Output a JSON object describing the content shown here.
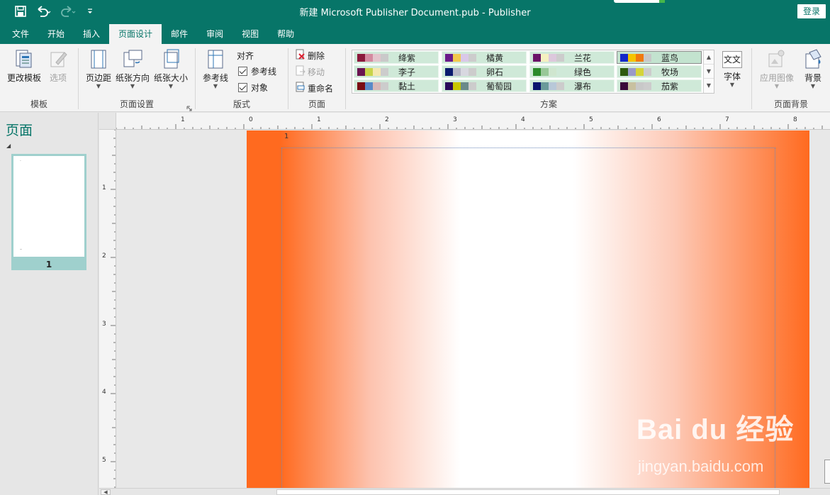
{
  "window": {
    "title": "新建 Microsoft Publisher Document.pub  -  Publisher",
    "login_label": "登录"
  },
  "qat": {
    "save_icon": "save-icon",
    "undo_icon": "undo-icon",
    "redo_icon": "redo-icon",
    "customize_icon": "customize-qat-icon"
  },
  "tabs": [
    {
      "label": "文件"
    },
    {
      "label": "开始"
    },
    {
      "label": "插入"
    },
    {
      "label": "页面设计",
      "active": true
    },
    {
      "label": "邮件"
    },
    {
      "label": "审阅"
    },
    {
      "label": "视图"
    },
    {
      "label": "帮助"
    }
  ],
  "ribbon": {
    "template_group": {
      "label": "模板",
      "change_template": "更改模板",
      "options": "选项"
    },
    "page_setup_group": {
      "label": "页面设置",
      "margins": "页边距",
      "orientation": "纸张方向",
      "size": "纸张大小"
    },
    "layout_group": {
      "label": "版式",
      "guides": "参考线",
      "align_label": "对齐",
      "align_guides": "参考线",
      "align_objects": "对象"
    },
    "pages_group": {
      "label": "页面",
      "delete": "删除",
      "move": "移动",
      "rename": "重命名"
    },
    "schemes_group": {
      "label": "方案",
      "font_label": "字体",
      "font_icon_text": "文文",
      "schemes": [
        {
          "name": "绛紫",
          "colors": [
            "#8b1a3c",
            "#d48aa0",
            "#e3c4cc",
            "#c9c9c9"
          ]
        },
        {
          "name": "橘黄",
          "colors": [
            "#6a1b8a",
            "#f2c84b",
            "#d9c8e8",
            "#cccccc"
          ]
        },
        {
          "name": "兰花",
          "colors": [
            "#6b1468",
            "#f5f0c0",
            "#dcc8dc",
            "#cccccc"
          ]
        },
        {
          "name": "蓝鸟",
          "colors": [
            "#1428c8",
            "#f5c400",
            "#f07a10",
            "#c8c8c8"
          ],
          "selected": true
        },
        {
          "name": "李子",
          "colors": [
            "#6a1450",
            "#c8d44a",
            "#f5e8b0",
            "#cccccc"
          ]
        },
        {
          "name": "卵石",
          "colors": [
            "#0a1a6e",
            "#b8b8c8",
            "#d8d8e0",
            "#cccccc"
          ]
        },
        {
          "name": "绿色",
          "colors": [
            "#2a8a2a",
            "#98c898",
            "#cfe6cf",
            "#cfe9d8"
          ]
        },
        {
          "name": "牧场",
          "colors": [
            "#2e5a0e",
            "#9a9ac8",
            "#d4d43a",
            "#cccccc"
          ]
        },
        {
          "name": "黏土",
          "colors": [
            "#7a0e14",
            "#5a8ac8",
            "#d8b8b8",
            "#cccccc"
          ]
        },
        {
          "name": "葡萄园",
          "colors": [
            "#2a0a5a",
            "#c8c800",
            "#6a8a8a",
            "#cccccc"
          ]
        },
        {
          "name": "瀑布",
          "colors": [
            "#0a146e",
            "#6a9a9a",
            "#b8c8d8",
            "#cccccc"
          ]
        },
        {
          "name": "茄紫",
          "colors": [
            "#3a0a3a",
            "#c8c0a0",
            "#c8c8c8",
            "#cccccc"
          ]
        }
      ]
    },
    "background_group": {
      "label": "页面背景",
      "apply_image": "应用图像",
      "background": "背景"
    }
  },
  "pagenav": {
    "title": "页面",
    "pages": [
      {
        "number": "1"
      }
    ]
  },
  "canvas": {
    "page_number_label": "1",
    "background_gradient": {
      "edge_color": "#ff6a1f",
      "center_color": "#ffffff"
    }
  },
  "rulers": {
    "horizontal_labels": [
      "1",
      "0",
      "1",
      "2",
      "3",
      "4",
      "5",
      "6",
      "7",
      "8"
    ],
    "vertical_labels": [
      "1",
      "2",
      "3",
      "4",
      "5"
    ]
  },
  "watermark": {
    "logo_text": "Bai du 经验",
    "url": "jingyan.baidu.com"
  }
}
